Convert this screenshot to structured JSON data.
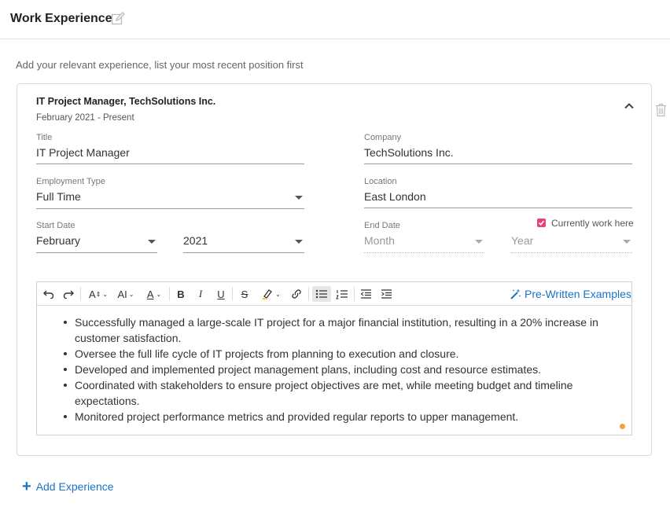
{
  "section": {
    "title": "Work Experience",
    "subtitle": "Add your relevant experience, list your most recent position first"
  },
  "entry": {
    "heading": "IT Project Manager, TechSolutions Inc.",
    "dates": "February 2021 - Present",
    "title": {
      "label": "Title",
      "value": "IT Project Manager"
    },
    "company": {
      "label": "Company",
      "value": "TechSolutions Inc."
    },
    "employment_type": {
      "label": "Employment Type",
      "value": "Full Time"
    },
    "location": {
      "label": "Location",
      "value": "East London"
    },
    "start_date": {
      "label": "Start Date",
      "month": "February",
      "year": "2021"
    },
    "end_date": {
      "label": "End Date",
      "month_placeholder": "Month",
      "year_placeholder": "Year"
    },
    "currently_work_here": {
      "label": "Currently work here",
      "checked": true,
      "color": "#e8407a"
    }
  },
  "editor": {
    "toolbar": {
      "undo": "undo-icon",
      "redo": "redo-icon",
      "font_size": "A",
      "line_height": "AI",
      "font_color": "A",
      "bold": "B",
      "italic": "I",
      "underline": "U",
      "strikethrough": "S",
      "highlight": "highlighter-icon",
      "link": "link-icon",
      "bullet_list": "bullet-list-icon",
      "numbered_list": "numbered-list-icon",
      "outdent": "outdent-icon",
      "indent": "indent-icon"
    },
    "prewritten_label": "Pre-Written Examples",
    "bullets": [
      "Successfully managed a large-scale IT project for a major financial institution, resulting in a 20% increase in customer satisfaction.",
      "Oversee the full life cycle of IT projects from planning to execution and closure.",
      "Developed and implemented project management plans, including cost and resource estimates.",
      "Coordinated with stakeholders to ensure project objectives are met, while meeting budget and timeline expectations.",
      "Monitored project performance metrics and provided regular reports to upper management."
    ]
  },
  "add_experience_label": "Add Experience",
  "colors": {
    "accent": "#1a73c7",
    "checkbox": "#e8407a",
    "status_dot": "#f5a03c"
  }
}
